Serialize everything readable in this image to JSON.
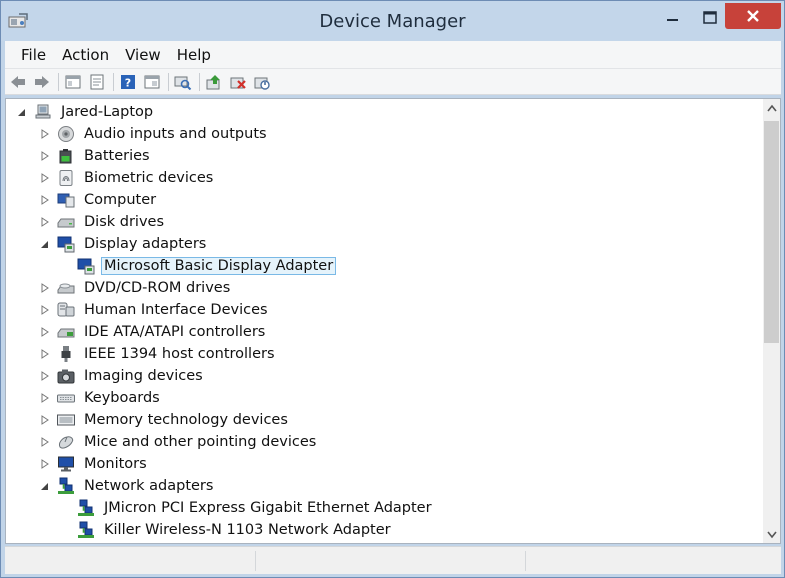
{
  "window": {
    "title": "Device Manager"
  },
  "menu": [
    {
      "label": "File"
    },
    {
      "label": "Action"
    },
    {
      "label": "View"
    },
    {
      "label": "Help"
    }
  ],
  "toolbar": [
    {
      "icon": "back-arrow-icon"
    },
    {
      "icon": "forward-arrow-icon"
    },
    {
      "icon": "properties-sheet-icon"
    },
    {
      "icon": "show-hide-pane-icon"
    },
    {
      "icon": "help-icon"
    },
    {
      "icon": "console-icon"
    },
    {
      "icon": "scan-hardware-icon"
    },
    {
      "icon": "update-driver-icon"
    },
    {
      "icon": "uninstall-device-icon"
    },
    {
      "icon": "disable-device-icon"
    }
  ],
  "tree": {
    "root": {
      "label": "Jared-Laptop",
      "icon": "computer-icon",
      "expanded": true
    },
    "categories": [
      {
        "label": "Audio inputs and outputs",
        "icon": "speaker-icon",
        "expanded": false
      },
      {
        "label": "Batteries",
        "icon": "battery-icon",
        "expanded": false
      },
      {
        "label": "Biometric devices",
        "icon": "fingerprint-icon",
        "expanded": false
      },
      {
        "label": "Computer",
        "icon": "computer-icon",
        "expanded": false
      },
      {
        "label": "Disk drives",
        "icon": "disk-drive-icon",
        "expanded": false
      },
      {
        "label": "Display adapters",
        "icon": "display-adapter-icon",
        "expanded": true,
        "children": [
          {
            "label": "Microsoft Basic Display Adapter",
            "icon": "display-adapter-icon",
            "selected": true
          }
        ]
      },
      {
        "label": "DVD/CD-ROM drives",
        "icon": "optical-drive-icon",
        "expanded": false
      },
      {
        "label": "Human Interface Devices",
        "icon": "hid-icon",
        "expanded": false
      },
      {
        "label": "IDE ATA/ATAPI controllers",
        "icon": "ide-controller-icon",
        "expanded": false
      },
      {
        "label": "IEEE 1394 host controllers",
        "icon": "firewire-icon",
        "expanded": false
      },
      {
        "label": "Imaging devices",
        "icon": "camera-icon",
        "expanded": false
      },
      {
        "label": "Keyboards",
        "icon": "keyboard-icon",
        "expanded": false
      },
      {
        "label": "Memory technology devices",
        "icon": "memory-icon",
        "expanded": false
      },
      {
        "label": "Mice and other pointing devices",
        "icon": "mouse-icon",
        "expanded": false
      },
      {
        "label": "Monitors",
        "icon": "monitor-icon",
        "expanded": false
      },
      {
        "label": "Network adapters",
        "icon": "network-adapter-icon",
        "expanded": true,
        "children": [
          {
            "label": "JMicron PCI Express Gigabit Ethernet Adapter",
            "icon": "network-adapter-icon"
          },
          {
            "label": "Killer Wireless-N 1103 Network Adapter",
            "icon": "network-adapter-icon"
          }
        ]
      }
    ]
  },
  "colors": {
    "titlebar": "#c3d6ea",
    "close_button": "#c7423a",
    "selection_bg": "#e5f3fb",
    "selection_border": "#7ab9e6"
  }
}
